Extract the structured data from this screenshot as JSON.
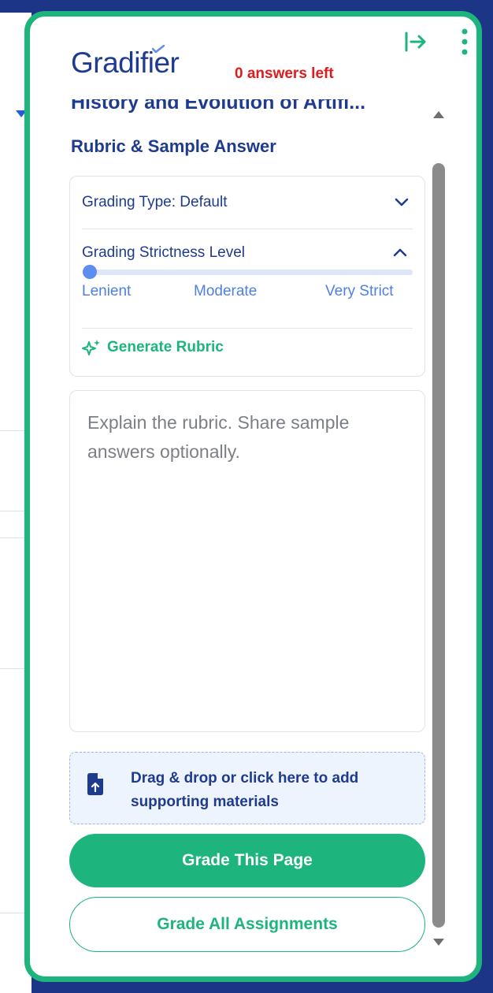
{
  "header": {
    "logo_text": "Gradifier",
    "answers_left": "0 answers left",
    "collapse_icon": "collapse-right-icon",
    "more_icon": "more-vertical-icon"
  },
  "assignment": {
    "title": "History and Evolution of Artifi..."
  },
  "rubric_section": {
    "title": "Rubric & Sample Answer",
    "grading_type": "Grading Type: Default",
    "strictness_label": "Grading Strictness Level",
    "strictness_levels": [
      "Lenient",
      "Moderate",
      "Very Strict"
    ],
    "strictness_selected": "Lenient",
    "generate_rubric": "Generate Rubric"
  },
  "rubric_input": {
    "placeholder": "Explain the rubric. Share sample answers optionally.",
    "value": ""
  },
  "dropzone": {
    "text": "Drag & drop or click here to add supporting materials",
    "icon": "file-upload-icon"
  },
  "actions": {
    "grade_page": "Grade This Page",
    "grade_all": "Grade All Assignments"
  },
  "colors": {
    "brand_green": "#1db47d",
    "brand_navy": "#1f3b8f",
    "alert_red": "#e01b1b",
    "accent_blue": "#4f7fe6",
    "background": "#1c3586"
  }
}
